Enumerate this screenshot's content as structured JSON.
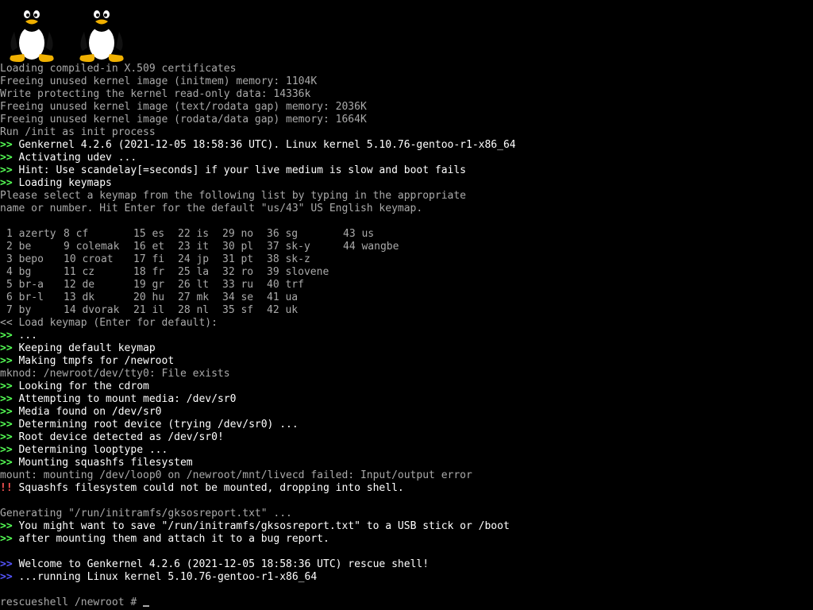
{
  "colors": {
    "background": "#000000",
    "text_normal": "#aaaaaa",
    "text_bright": "#ffffff",
    "marker_ok": "#55ff55",
    "marker_error": "#ff5555",
    "marker_info": "#5555ff"
  },
  "logos": [
    {
      "icon": "tux-penguin-icon"
    },
    {
      "icon": "tux-penguin-icon"
    }
  ],
  "lines": [
    {
      "marker": "",
      "text": "Loading compiled-in X.509 certificates"
    },
    {
      "marker": "",
      "text": "Freeing unused kernel image (initmem) memory: 1104K"
    },
    {
      "marker": "",
      "text": "Write protecting the kernel read-only data: 14336k"
    },
    {
      "marker": "",
      "text": "Freeing unused kernel image (text/rodata gap) memory: 2036K"
    },
    {
      "marker": "",
      "text": "Freeing unused kernel image (rodata/data gap) memory: 1664K"
    },
    {
      "marker": "",
      "text": "Run /init as init process"
    },
    {
      "marker": ">>",
      "text": "Genkernel 4.2.6 (2021-12-05 18:58:36 UTC). Linux kernel 5.10.76-gentoo-r1-x86_64"
    },
    {
      "marker": ">>",
      "text": "Activating udev ..."
    },
    {
      "marker": ">>",
      "text": "Hint: Use scandelay[=seconds] if your live medium is slow and boot fails"
    },
    {
      "marker": ">>",
      "text": "Loading keymaps"
    },
    {
      "marker": "",
      "text": "Please select a keymap from the following list by typing in the appropriate"
    },
    {
      "marker": "",
      "text": "name or number. Hit Enter for the default \"us/43\" US English keymap."
    },
    {
      "marker": "",
      "text": ""
    }
  ],
  "keymap_columns": [
    [
      {
        "num": "1",
        "name": "azerty"
      },
      {
        "num": "2",
        "name": "be"
      },
      {
        "num": "3",
        "name": "bepo"
      },
      {
        "num": "4",
        "name": "bg"
      },
      {
        "num": "5",
        "name": "br-a"
      },
      {
        "num": "6",
        "name": "br-l"
      },
      {
        "num": "7",
        "name": "by"
      }
    ],
    [
      {
        "num": "8",
        "name": "cf"
      },
      {
        "num": "9",
        "name": "colemak"
      },
      {
        "num": "10",
        "name": "croat"
      },
      {
        "num": "11",
        "name": "cz"
      },
      {
        "num": "12",
        "name": "de"
      },
      {
        "num": "13",
        "name": "dk"
      },
      {
        "num": "14",
        "name": "dvorak"
      }
    ],
    [
      {
        "num": "15",
        "name": "es"
      },
      {
        "num": "16",
        "name": "et"
      },
      {
        "num": "17",
        "name": "fi"
      },
      {
        "num": "18",
        "name": "fr"
      },
      {
        "num": "19",
        "name": "gr"
      },
      {
        "num": "20",
        "name": "hu"
      },
      {
        "num": "21",
        "name": "il"
      }
    ],
    [
      {
        "num": "22",
        "name": "is"
      },
      {
        "num": "23",
        "name": "it"
      },
      {
        "num": "24",
        "name": "jp"
      },
      {
        "num": "25",
        "name": "la"
      },
      {
        "num": "26",
        "name": "lt"
      },
      {
        "num": "27",
        "name": "mk"
      },
      {
        "num": "28",
        "name": "nl"
      }
    ],
    [
      {
        "num": "29",
        "name": "no"
      },
      {
        "num": "30",
        "name": "pl"
      },
      {
        "num": "31",
        "name": "pt"
      },
      {
        "num": "32",
        "name": "ro"
      },
      {
        "num": "33",
        "name": "ru"
      },
      {
        "num": "34",
        "name": "se"
      },
      {
        "num": "35",
        "name": "sf"
      }
    ],
    [
      {
        "num": "36",
        "name": "sg"
      },
      {
        "num": "37",
        "name": "sk-y"
      },
      {
        "num": "38",
        "name": "sk-z"
      },
      {
        "num": "39",
        "name": "slovene"
      },
      {
        "num": "40",
        "name": "trf"
      },
      {
        "num": "41",
        "name": "ua"
      },
      {
        "num": "42",
        "name": "uk"
      }
    ],
    [
      {
        "num": "43",
        "name": "us"
      },
      {
        "num": "44",
        "name": "wangbe"
      }
    ]
  ],
  "lines_after": [
    {
      "marker": "<<",
      "text": "Load keymap (Enter for default):"
    },
    {
      "marker": ">>",
      "text": "..."
    },
    {
      "marker": ">>",
      "text": "Keeping default keymap"
    },
    {
      "marker": ">>",
      "text": "Making tmpfs for /newroot"
    },
    {
      "marker": "",
      "text": "mknod: /newroot/dev/tty0: File exists"
    },
    {
      "marker": ">>",
      "text": "Looking for the cdrom"
    },
    {
      "marker": ">>",
      "text": "Attempting to mount media: /dev/sr0"
    },
    {
      "marker": ">>",
      "text": "Media found on /dev/sr0"
    },
    {
      "marker": ">>",
      "text": "Determining root device (trying /dev/sr0) ..."
    },
    {
      "marker": ">>",
      "text": "Root device detected as /dev/sr0!"
    },
    {
      "marker": ">>",
      "text": "Determining looptype ..."
    },
    {
      "marker": ">>",
      "text": "Mounting squashfs filesystem"
    },
    {
      "marker": "",
      "text": "mount: mounting /dev/loop0 on /newroot/mnt/livecd failed: Input/output error"
    },
    {
      "marker": "!!",
      "text": "Squashfs filesystem could not be mounted, dropping into shell."
    },
    {
      "marker": "",
      "text": ""
    },
    {
      "marker": "",
      "text": "Generating \"/run/initramfs/gksosreport.txt\" ..."
    },
    {
      "marker": ">>",
      "text": "You might want to save \"/run/initramfs/gksosreport.txt\" to a USB stick or /boot"
    },
    {
      "marker": ">>",
      "text": "after mounting them and attach it to a bug report."
    },
    {
      "marker": "",
      "text": ""
    },
    {
      "marker": ">> ",
      "kind": "info",
      "text": "Welcome to Genkernel 4.2.6 (2021-12-05 18:58:36 UTC) rescue shell!"
    },
    {
      "marker": ">> ",
      "kind": "info",
      "text": "...running Linux kernel 5.10.76-gentoo-r1-x86_64"
    },
    {
      "marker": "",
      "text": ""
    }
  ],
  "prompt": {
    "text": "rescueshell /newroot # "
  }
}
